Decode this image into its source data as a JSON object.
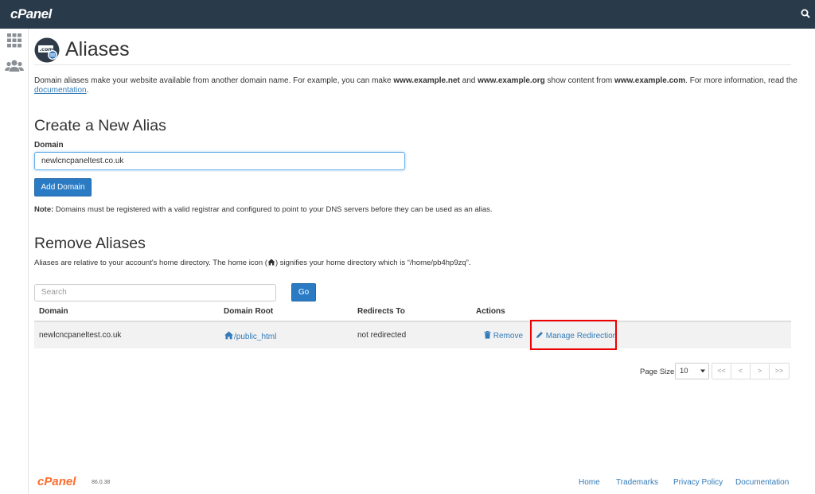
{
  "header": {
    "logo": "cPanel"
  },
  "page": {
    "title": "Aliases",
    "description_parts": {
      "p1": "Domain aliases make your website available from another domain name. For example, you can make ",
      "b1": "www.example.net",
      "p2": " and ",
      "b2": "www.example.org",
      "p3": " show content from ",
      "b3": "www.example.com",
      "p4": ". For more information, read the ",
      "link": "documentation",
      "p5": "."
    }
  },
  "create": {
    "title": "Create a New Alias",
    "domain_label": "Domain",
    "domain_value": "newlcncpaneltest.co.uk",
    "add_button": "Add Domain",
    "note_bold": "Note:",
    "note_text": " Domains must be registered with a valid registrar and configured to point to your DNS servers before they can be used as an alias."
  },
  "remove": {
    "title": "Remove Aliases",
    "desc_p1": "Aliases are relative to your account's home directory. The home icon (",
    "desc_p2": ") signifies your home directory which is “/home/pb4hp9zq”.",
    "search_placeholder": "Search",
    "go_button": "Go",
    "columns": [
      "Domain",
      "Domain Root",
      "Redirects To",
      "Actions"
    ],
    "rows": [
      {
        "domain": "newlcncpaneltest.co.uk",
        "root": "/public_html",
        "redirects": "not redirected",
        "remove": "Remove",
        "manage": "Manage Redirection"
      }
    ]
  },
  "pagination": {
    "page_size_label": "Page Size",
    "page_size": "10",
    "buttons": [
      "<<",
      "<",
      ">",
      ">>"
    ]
  },
  "footer": {
    "logo": "cPanel",
    "version": "86.0.38",
    "links": [
      "Home",
      "Trademarks",
      "Privacy Policy",
      "Documentation"
    ]
  },
  "colors": {
    "topbar": "#293a4a",
    "primary": "#2b7bc4",
    "link": "#337ab7",
    "highlight": "#ee0000",
    "footer_logo": "#ff6c2c"
  },
  "icons": {
    "top_search": "search-icon",
    "nav1": "grid-icon",
    "nav2": "users-icon",
    "page": "aliases-icon",
    "home": "home-icon",
    "remove": "trash-icon",
    "manage": "pencil-icon"
  }
}
